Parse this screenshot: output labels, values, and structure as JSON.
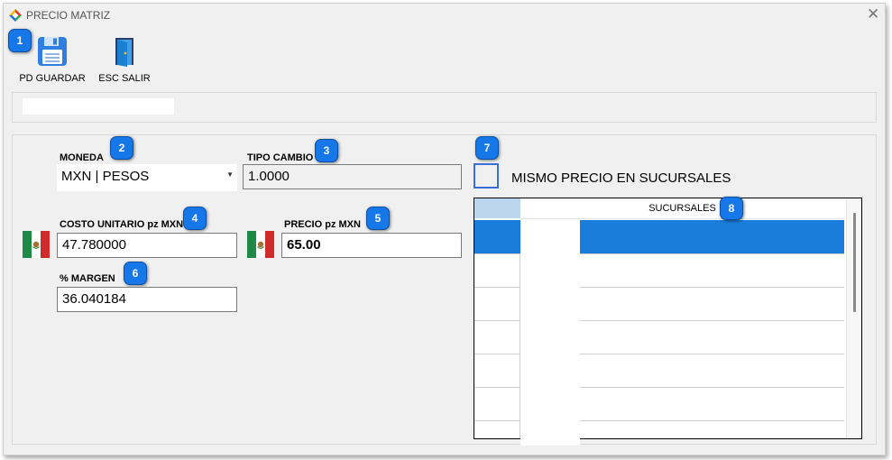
{
  "window": {
    "title": "PRECIO MATRIZ",
    "close_icon": "close-icon"
  },
  "toolbar": {
    "save_label": "PD GUARDAR",
    "exit_label": "ESC SALIR"
  },
  "form": {
    "moneda_label": "MONEDA",
    "moneda_value": "MXN | PESOS",
    "tipo_cambio_label": "TIPO CAMBIO",
    "tipo_cambio_value": "1.0000",
    "costo_label": "COSTO UNITARIO pz MXN",
    "costo_value": "47.780000",
    "precio_label": "PRECIO pz MXN",
    "precio_value": "65.00",
    "margen_label": "% MARGEN",
    "margen_value": "36.040184"
  },
  "checkbox": {
    "label": "MISMO PRECIO EN SUCURSALES",
    "checked": false
  },
  "grid": {
    "column_header": "SUCURSALES",
    "rows": [
      "",
      "",
      "",
      "",
      "",
      "",
      ""
    ],
    "selected_row": 0
  },
  "badges": [
    "1",
    "2",
    "3",
    "4",
    "5",
    "6",
    "7",
    "8"
  ],
  "colors": {
    "badge": "#1677e8",
    "selection": "#1a7ddb",
    "checkbox_border": "#3a6fd8"
  }
}
